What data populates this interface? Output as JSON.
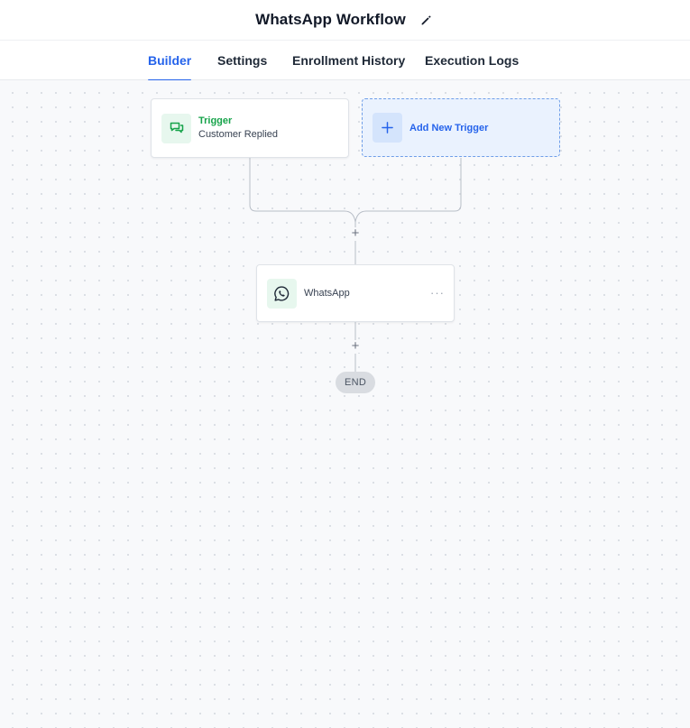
{
  "header": {
    "title": "WhatsApp Workflow",
    "edit_icon": "pencil-icon"
  },
  "tabs": [
    {
      "label": "Builder",
      "active": true
    },
    {
      "label": "Settings",
      "active": false
    },
    {
      "label": "Enrollment History",
      "active": false
    },
    {
      "label": "Execution Logs",
      "active": false
    }
  ],
  "workflow": {
    "trigger": {
      "label": "Trigger",
      "value": "Customer Replied",
      "icon": "chat-bubbles-icon"
    },
    "add_trigger": {
      "label": "Add New Trigger",
      "icon": "plus-icon"
    },
    "action": {
      "label": "WhatsApp",
      "icon": "whatsapp-icon",
      "menu": "···"
    },
    "add_step_symbol": "+",
    "end_label": "END"
  },
  "colors": {
    "accent": "#2563eb",
    "trigger_green": "#16a34a",
    "canvas_bg": "#f8f9fb",
    "add_trigger_bg": "#eaf2fe"
  }
}
